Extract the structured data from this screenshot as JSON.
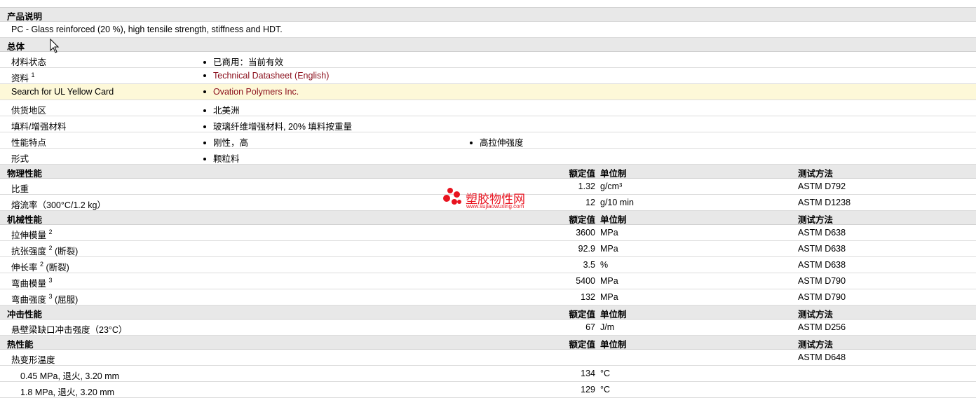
{
  "product": {
    "header": "产品说明",
    "description": "PC - Glass reinforced (20 %), high tensile strength, stiffness and HDT."
  },
  "general": {
    "header": "总体",
    "rows": [
      {
        "label": "材料状态",
        "values": [
          "已商用：当前有效"
        ]
      },
      {
        "label": "资料",
        "sup": "1",
        "values": [
          "Technical Datasheet (English)"
        ],
        "link": true
      },
      {
        "label": "Search for UL Yellow Card",
        "values": [
          "Ovation Polymers Inc."
        ],
        "link": true,
        "highlight": true
      },
      {
        "label": "供货地区",
        "values": [
          "北美洲"
        ]
      },
      {
        "label": "填料/增强材料",
        "values": [
          "玻璃纤维增强材料, 20% 填料按重量"
        ]
      },
      {
        "label": "性能特点",
        "values": [
          "刚性，高",
          "高拉伸强度"
        ]
      },
      {
        "label": "形式",
        "values": [
          "颗粒料"
        ]
      }
    ]
  },
  "columns": {
    "nominal": "额定值",
    "unit": "单位制",
    "method": "测试方法"
  },
  "sections": [
    {
      "header": "物理性能",
      "rows": [
        {
          "label": "比重",
          "value": "1.32",
          "unit": "g/cm³",
          "method": "ASTM D792"
        },
        {
          "label": "熔流率（300°C/1.2 kg）",
          "value": "12",
          "unit": "g/10 min",
          "method": "ASTM D1238"
        }
      ]
    },
    {
      "header": "机械性能",
      "rows": [
        {
          "label": "拉伸模量",
          "sup": "2",
          "suffix": "",
          "value": "3600",
          "unit": "MPa",
          "method": "ASTM D638"
        },
        {
          "label": "抗张强度",
          "sup": "2",
          "suffix": "(断裂)",
          "value": "92.9",
          "unit": "MPa",
          "method": "ASTM D638"
        },
        {
          "label": "伸长率",
          "sup": "2",
          "suffix": "(断裂)",
          "value": "3.5",
          "unit": "%",
          "method": "ASTM D638"
        },
        {
          "label": "弯曲模量",
          "sup": "3",
          "suffix": "",
          "value": "5400",
          "unit": "MPa",
          "method": "ASTM D790"
        },
        {
          "label": "弯曲强度",
          "sup": "3",
          "suffix": "(屈服)",
          "value": "132",
          "unit": "MPa",
          "method": "ASTM D790"
        }
      ]
    },
    {
      "header": "冲击性能",
      "rows": [
        {
          "label": "悬壁梁缺口冲击强度（23°C）",
          "value": "67",
          "unit": "J/m",
          "method": "ASTM D256"
        }
      ]
    },
    {
      "header": "热性能",
      "rows": [
        {
          "label": "热变形温度",
          "value": "",
          "unit": "",
          "method": "ASTM D648"
        },
        {
          "label": "0.45 MPa, 退火, 3.20 mm",
          "indent": true,
          "value": "134",
          "unit": "°C",
          "method": ""
        },
        {
          "label": "1.8 MPa, 退火, 3.20 mm",
          "indent": true,
          "value": "129",
          "unit": "°C",
          "method": ""
        }
      ]
    }
  ],
  "watermark": {
    "title": "塑胶物性网",
    "url": "www.sujiaowuxing.com"
  },
  "colors": {
    "link": "#8b0f1c",
    "header_bg": "#e8e8e8",
    "highlight_bg": "#fdf8d8",
    "watermark": "#e8131f"
  }
}
